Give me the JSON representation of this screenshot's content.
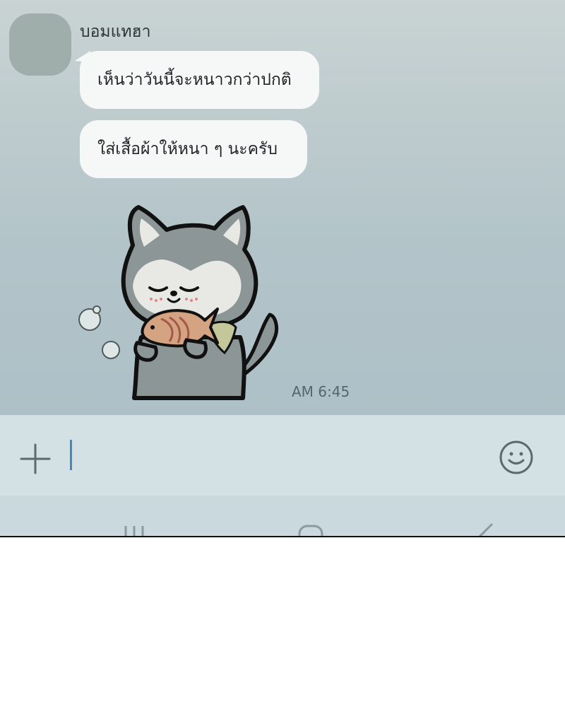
{
  "chat": {
    "sender_name": "บอมแทฮา",
    "messages": [
      {
        "text": "เห็นว่าวันนี้จะหนาวกว่าปกติ"
      },
      {
        "text": "ใส่เสื้อผ้าให้หนา ๆ นะครับ"
      }
    ],
    "sticker": {
      "icon": "wolf-eating-taiyaki-sticker"
    },
    "timestamp": "AM 6:45"
  },
  "input": {
    "value": "",
    "placeholder": "",
    "add_icon": "plus-icon",
    "emoji_icon": "smiley-icon"
  },
  "navigation": {
    "icons": [
      "recent-apps-icon",
      "home-icon",
      "back-icon"
    ]
  },
  "colors": {
    "chat_background": "#b3c4c9",
    "bubble": "#f6f8f8",
    "input_bar": "#d3e1e5",
    "nav_bar": "#c9d9de",
    "caret": "#4a86b8"
  }
}
